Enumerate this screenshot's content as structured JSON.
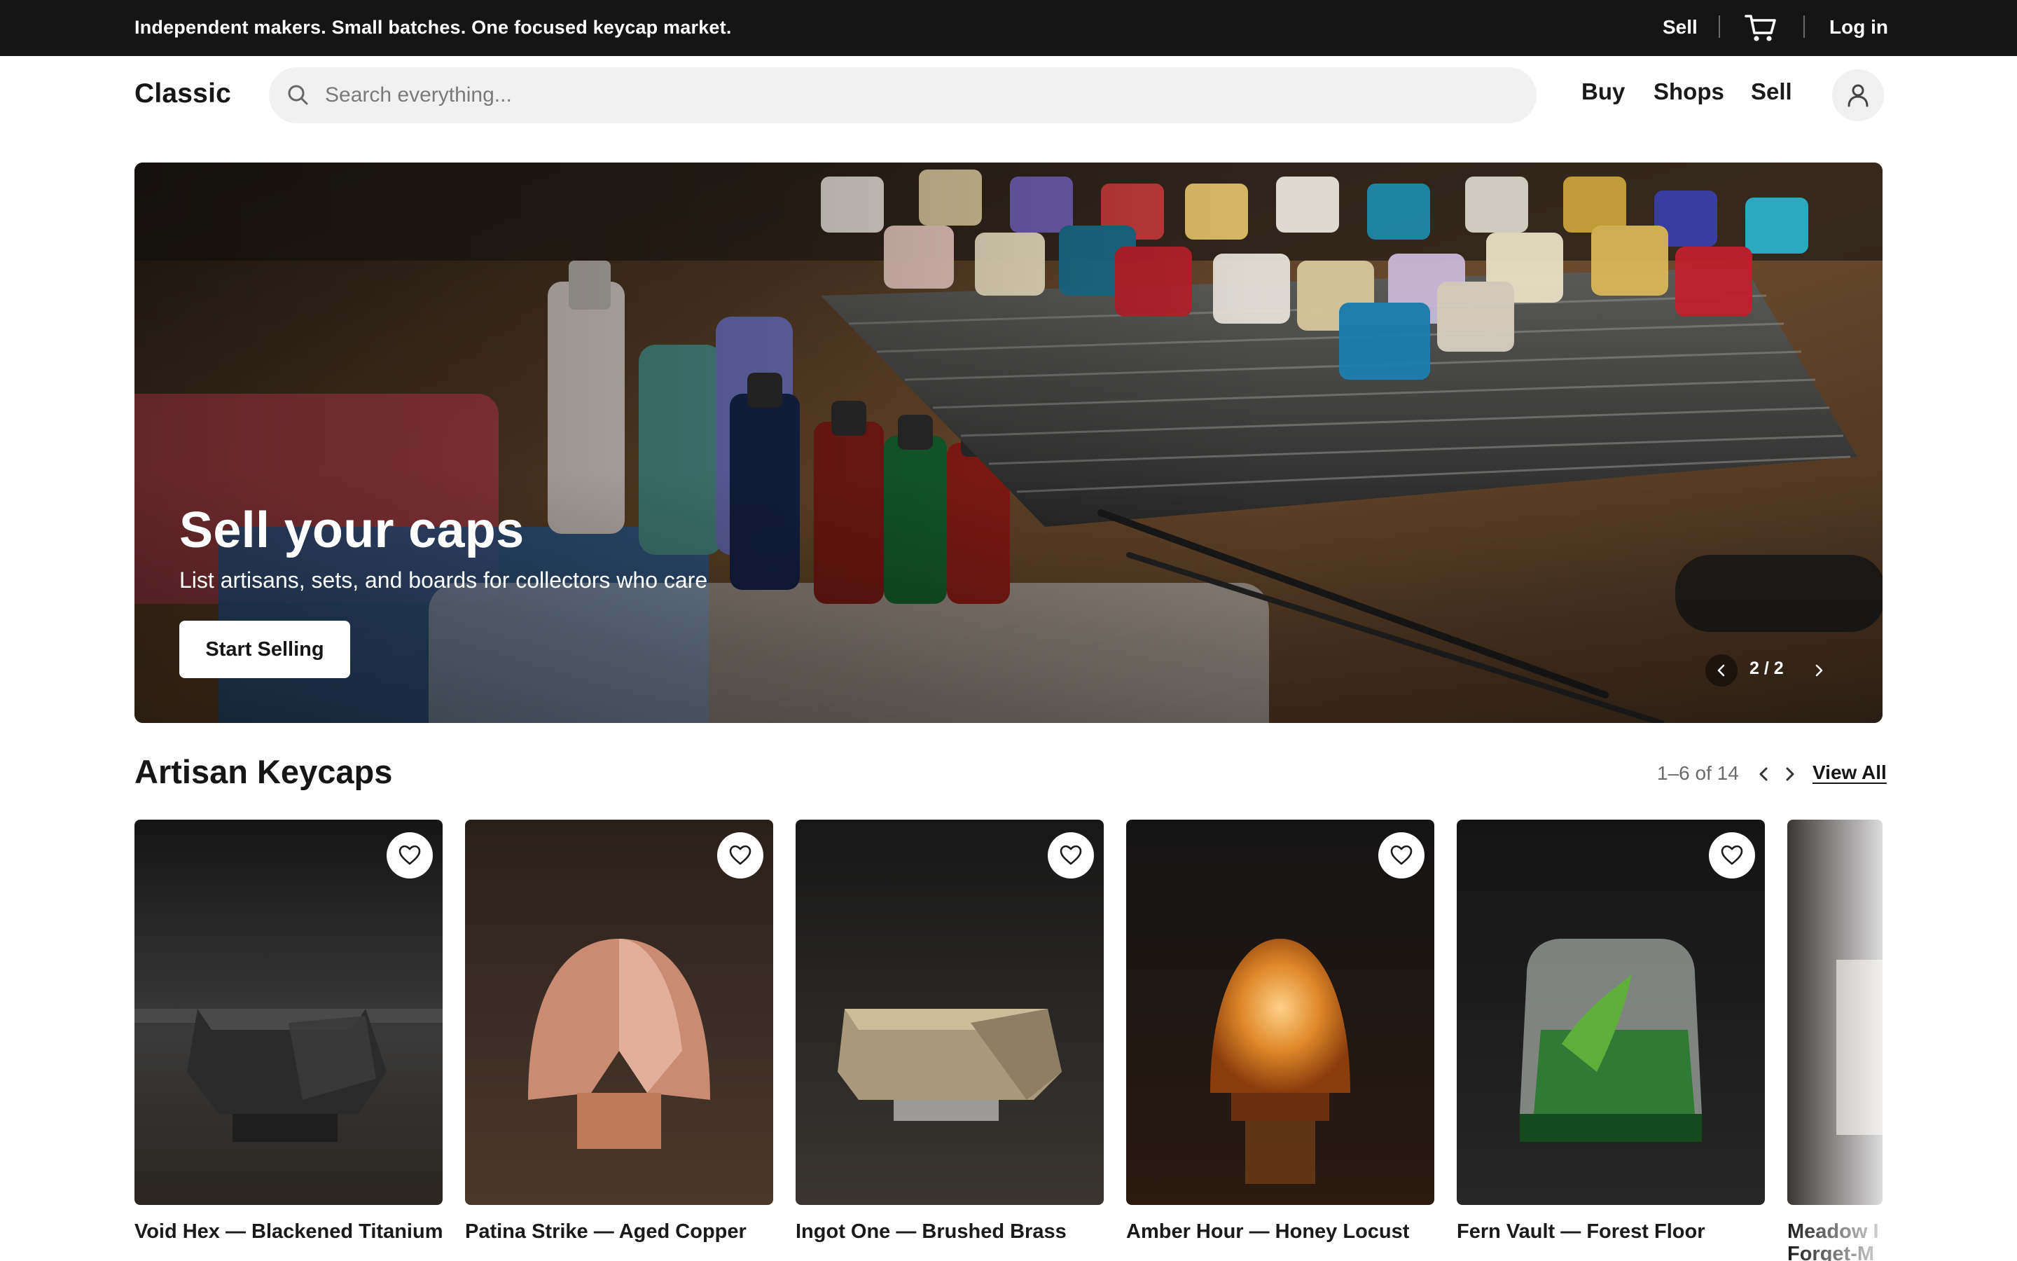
{
  "topbar": {
    "tagline": "Independent makers. Small batches. One focused keycap market.",
    "sell": "Sell",
    "cart_icon": "cart-icon",
    "login": "Log in"
  },
  "header": {
    "logo": "Classic",
    "search_placeholder": "Search everything...",
    "search_value": "",
    "nav": {
      "buy": "Buy",
      "shops": "Shops",
      "sell": "Sell"
    },
    "account_icon": "user-icon"
  },
  "hero": {
    "title": "Sell your caps",
    "subtitle": "List artisans, sets, and boards for collectors who care",
    "cta": "Start Selling",
    "pager": "2 / 2"
  },
  "section": {
    "title": "Artisan Keycaps",
    "range": "1–6 of 14",
    "view_all": "View All"
  },
  "products": [
    {
      "name": "Void Hex — Blackened Titanium"
    },
    {
      "name": "Patina Strike — Aged Copper"
    },
    {
      "name": "Ingot One — Brushed Brass"
    },
    {
      "name": "Amber Hour — Honey Locust"
    },
    {
      "name": "Fern Vault — Forest Floor"
    },
    {
      "name": "Meadow I Forget-M"
    }
  ],
  "colors": {
    "topbar_bg": "#151515",
    "search_bg": "#f1f1f1",
    "text": "#161616",
    "muted": "#6b6b6b"
  }
}
